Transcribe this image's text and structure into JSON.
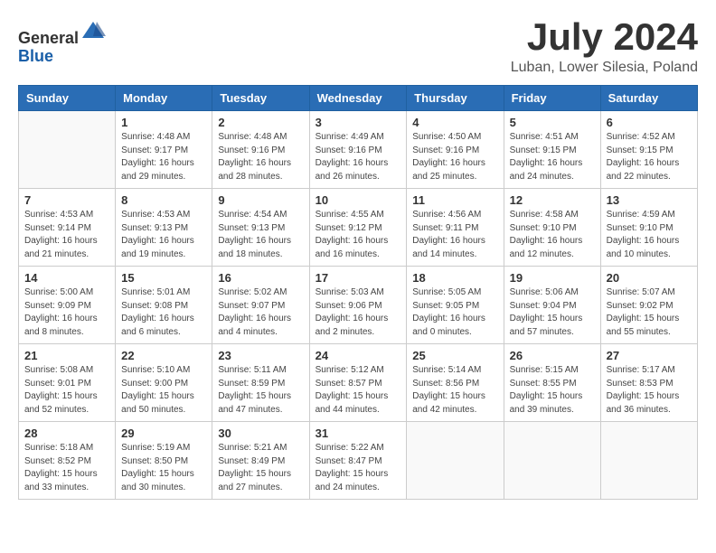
{
  "header": {
    "logo_general": "General",
    "logo_blue": "Blue",
    "title": "July 2024",
    "subtitle": "Luban, Lower Silesia, Poland"
  },
  "days_of_week": [
    "Sunday",
    "Monday",
    "Tuesday",
    "Wednesday",
    "Thursday",
    "Friday",
    "Saturday"
  ],
  "weeks": [
    [
      {
        "day": "",
        "info": ""
      },
      {
        "day": "1",
        "info": "Sunrise: 4:48 AM\nSunset: 9:17 PM\nDaylight: 16 hours\nand 29 minutes."
      },
      {
        "day": "2",
        "info": "Sunrise: 4:48 AM\nSunset: 9:16 PM\nDaylight: 16 hours\nand 28 minutes."
      },
      {
        "day": "3",
        "info": "Sunrise: 4:49 AM\nSunset: 9:16 PM\nDaylight: 16 hours\nand 26 minutes."
      },
      {
        "day": "4",
        "info": "Sunrise: 4:50 AM\nSunset: 9:16 PM\nDaylight: 16 hours\nand 25 minutes."
      },
      {
        "day": "5",
        "info": "Sunrise: 4:51 AM\nSunset: 9:15 PM\nDaylight: 16 hours\nand 24 minutes."
      },
      {
        "day": "6",
        "info": "Sunrise: 4:52 AM\nSunset: 9:15 PM\nDaylight: 16 hours\nand 22 minutes."
      }
    ],
    [
      {
        "day": "7",
        "info": "Sunrise: 4:53 AM\nSunset: 9:14 PM\nDaylight: 16 hours\nand 21 minutes."
      },
      {
        "day": "8",
        "info": "Sunrise: 4:53 AM\nSunset: 9:13 PM\nDaylight: 16 hours\nand 19 minutes."
      },
      {
        "day": "9",
        "info": "Sunrise: 4:54 AM\nSunset: 9:13 PM\nDaylight: 16 hours\nand 18 minutes."
      },
      {
        "day": "10",
        "info": "Sunrise: 4:55 AM\nSunset: 9:12 PM\nDaylight: 16 hours\nand 16 minutes."
      },
      {
        "day": "11",
        "info": "Sunrise: 4:56 AM\nSunset: 9:11 PM\nDaylight: 16 hours\nand 14 minutes."
      },
      {
        "day": "12",
        "info": "Sunrise: 4:58 AM\nSunset: 9:10 PM\nDaylight: 16 hours\nand 12 minutes."
      },
      {
        "day": "13",
        "info": "Sunrise: 4:59 AM\nSunset: 9:10 PM\nDaylight: 16 hours\nand 10 minutes."
      }
    ],
    [
      {
        "day": "14",
        "info": "Sunrise: 5:00 AM\nSunset: 9:09 PM\nDaylight: 16 hours\nand 8 minutes."
      },
      {
        "day": "15",
        "info": "Sunrise: 5:01 AM\nSunset: 9:08 PM\nDaylight: 16 hours\nand 6 minutes."
      },
      {
        "day": "16",
        "info": "Sunrise: 5:02 AM\nSunset: 9:07 PM\nDaylight: 16 hours\nand 4 minutes."
      },
      {
        "day": "17",
        "info": "Sunrise: 5:03 AM\nSunset: 9:06 PM\nDaylight: 16 hours\nand 2 minutes."
      },
      {
        "day": "18",
        "info": "Sunrise: 5:05 AM\nSunset: 9:05 PM\nDaylight: 16 hours\nand 0 minutes."
      },
      {
        "day": "19",
        "info": "Sunrise: 5:06 AM\nSunset: 9:04 PM\nDaylight: 15 hours\nand 57 minutes."
      },
      {
        "day": "20",
        "info": "Sunrise: 5:07 AM\nSunset: 9:02 PM\nDaylight: 15 hours\nand 55 minutes."
      }
    ],
    [
      {
        "day": "21",
        "info": "Sunrise: 5:08 AM\nSunset: 9:01 PM\nDaylight: 15 hours\nand 52 minutes."
      },
      {
        "day": "22",
        "info": "Sunrise: 5:10 AM\nSunset: 9:00 PM\nDaylight: 15 hours\nand 50 minutes."
      },
      {
        "day": "23",
        "info": "Sunrise: 5:11 AM\nSunset: 8:59 PM\nDaylight: 15 hours\nand 47 minutes."
      },
      {
        "day": "24",
        "info": "Sunrise: 5:12 AM\nSunset: 8:57 PM\nDaylight: 15 hours\nand 44 minutes."
      },
      {
        "day": "25",
        "info": "Sunrise: 5:14 AM\nSunset: 8:56 PM\nDaylight: 15 hours\nand 42 minutes."
      },
      {
        "day": "26",
        "info": "Sunrise: 5:15 AM\nSunset: 8:55 PM\nDaylight: 15 hours\nand 39 minutes."
      },
      {
        "day": "27",
        "info": "Sunrise: 5:17 AM\nSunset: 8:53 PM\nDaylight: 15 hours\nand 36 minutes."
      }
    ],
    [
      {
        "day": "28",
        "info": "Sunrise: 5:18 AM\nSunset: 8:52 PM\nDaylight: 15 hours\nand 33 minutes."
      },
      {
        "day": "29",
        "info": "Sunrise: 5:19 AM\nSunset: 8:50 PM\nDaylight: 15 hours\nand 30 minutes."
      },
      {
        "day": "30",
        "info": "Sunrise: 5:21 AM\nSunset: 8:49 PM\nDaylight: 15 hours\nand 27 minutes."
      },
      {
        "day": "31",
        "info": "Sunrise: 5:22 AM\nSunset: 8:47 PM\nDaylight: 15 hours\nand 24 minutes."
      },
      {
        "day": "",
        "info": ""
      },
      {
        "day": "",
        "info": ""
      },
      {
        "day": "",
        "info": ""
      }
    ]
  ]
}
